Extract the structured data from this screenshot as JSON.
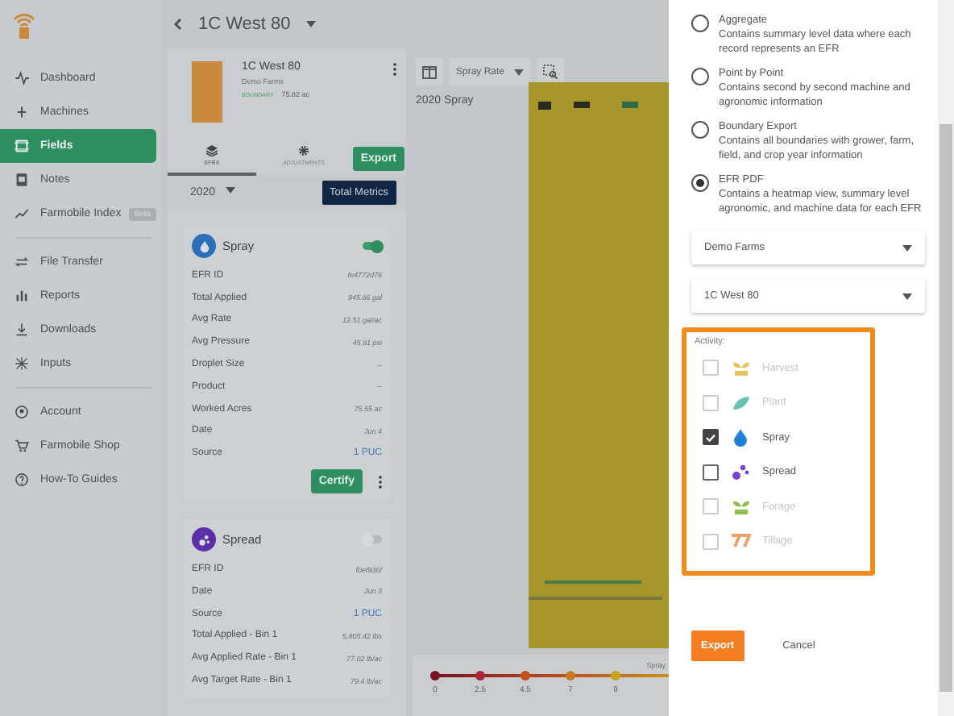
{
  "header": {
    "title": "1C West 80"
  },
  "sidebar": {
    "items": [
      {
        "label": "Dashboard",
        "selected": false
      },
      {
        "label": "Machines",
        "selected": false
      },
      {
        "label": "Fields",
        "selected": true
      },
      {
        "label": "Notes",
        "selected": false
      },
      {
        "label": "Farmobile Index",
        "selected": false,
        "badge": "Beta"
      },
      {
        "label": "File Transfer",
        "selected": false
      },
      {
        "label": "Reports",
        "selected": false
      },
      {
        "label": "Downloads",
        "selected": false
      },
      {
        "label": "Inputs",
        "selected": false
      },
      {
        "label": "Account",
        "selected": false
      },
      {
        "label": "Farmobile Shop",
        "selected": false
      },
      {
        "label": "How-To Guides",
        "selected": false
      }
    ]
  },
  "field": {
    "name": "1C West 80",
    "farm": "Demo Farms",
    "boundary_label": "BOUNDARY",
    "area": "75.82 ac"
  },
  "tabs": [
    {
      "label": "EFRS",
      "selected": true
    },
    {
      "label": "ADJUSTMENTS",
      "selected": false
    }
  ],
  "export_button": "Export",
  "year": "2020",
  "total_metrics_button": "Total Metrics",
  "efr_cards": [
    {
      "kind": "spray",
      "title": "Spray",
      "on": true,
      "rows": [
        {
          "label": "EFR ID",
          "value": "fe4772d76"
        },
        {
          "label": "Total Applied",
          "value": "945.86 gal"
        },
        {
          "label": "Avg Rate",
          "value": "12.51 gal/ac"
        },
        {
          "label": "Avg Pressure",
          "value": "45.91 psi"
        },
        {
          "label": "Droplet Size",
          "value": "--"
        },
        {
          "label": "Product",
          "value": "--"
        },
        {
          "label": "Worked Acres",
          "value": "75.55 ac"
        },
        {
          "label": "Date",
          "value": "Jun 4"
        },
        {
          "label": "Source",
          "value": "1 PUC",
          "kind": "link"
        }
      ],
      "certify_button": "Certify"
    },
    {
      "kind": "spread",
      "title": "Spread",
      "on": false,
      "rows": [
        {
          "label": "EFR ID",
          "value": "f0ef936f"
        },
        {
          "label": "Date",
          "value": "Jun 3"
        },
        {
          "label": "Source",
          "value": "1 PUC",
          "kind": "link"
        },
        {
          "label": "Total Applied - Bin 1",
          "value": "5,805.42 lbs"
        },
        {
          "label": "Avg Applied Rate - Bin 1",
          "value": "77.02 lb/ac"
        },
        {
          "label": "Avg Target Rate - Bin 1",
          "value": "79.4 lb/ac"
        }
      ]
    }
  ],
  "map": {
    "layer_dropdown": "Spray Rate",
    "label": "2020 Spray",
    "legend": {
      "title": "Spray",
      "stops": [
        {
          "label": "0",
          "color": "#7a1020"
        },
        {
          "label": "2.5",
          "color": "#a8283a"
        },
        {
          "label": "4.5",
          "color": "#c0501e"
        },
        {
          "label": "7",
          "color": "#c87a22"
        },
        {
          "label": "9",
          "color": "#c9a21e"
        }
      ]
    }
  },
  "export_dialog": {
    "options": [
      {
        "title": "Aggregate",
        "description": "Contains summary level data where each record represents an EFR",
        "selected": false
      },
      {
        "title": "Point by Point",
        "description": "Contains second by second machine and agronomic information",
        "selected": false
      },
      {
        "title": "Boundary Export",
        "description": "Contains all boundaries with grower, farm, field, and crop year information",
        "selected": false
      },
      {
        "title": "EFR PDF",
        "description": "Contains a heatmap view, summary level agronomic, and machine data for each EFR",
        "selected": true
      }
    ],
    "farm_select": "Demo Farms",
    "field_select": "1C West 80",
    "activity_label": "Activity:",
    "activities": [
      {
        "kind": "harvest",
        "label": "Harvest",
        "checked": false,
        "disabled": true
      },
      {
        "kind": "plant",
        "label": "Plant",
        "checked": false,
        "disabled": true
      },
      {
        "kind": "spray",
        "label": "Spray",
        "checked": true,
        "disabled": false
      },
      {
        "kind": "spread",
        "label": "Spread",
        "checked": false,
        "disabled": false
      },
      {
        "kind": "forage",
        "label": "Forage",
        "checked": false,
        "disabled": true
      },
      {
        "kind": "tillage",
        "label": "Tillage",
        "checked": false,
        "disabled": true
      }
    ],
    "export_button": "Export",
    "cancel_button": "Cancel"
  }
}
